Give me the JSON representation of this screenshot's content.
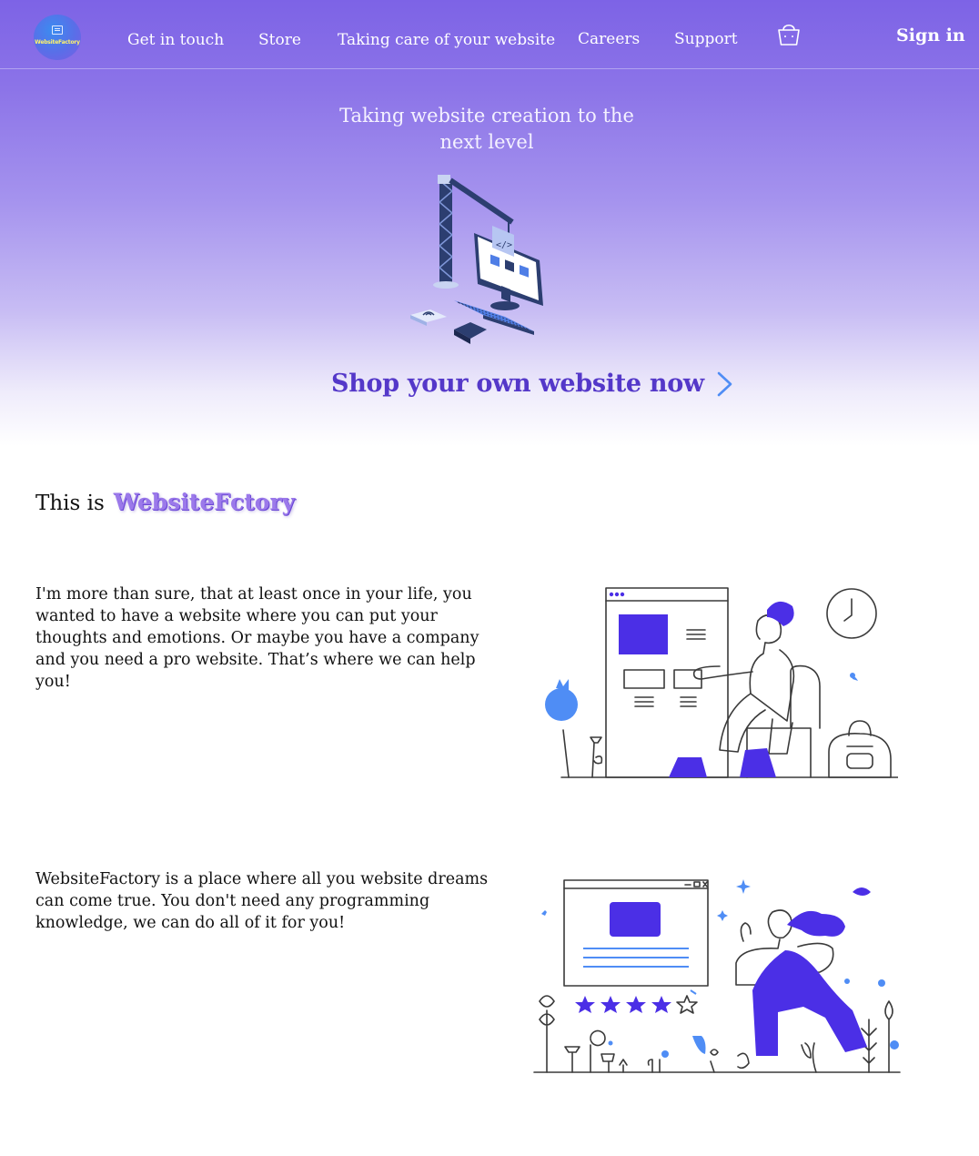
{
  "brand": {
    "logo_text": "WebsiteFactory"
  },
  "nav": {
    "links": [
      {
        "label": "Get in touch"
      },
      {
        "label": "Store"
      },
      {
        "label": "Taking care of your website"
      },
      {
        "label": "Careers"
      },
      {
        "label": "Support"
      }
    ],
    "cart_icon": "shopping-basket-icon",
    "sign_in": "Sign in"
  },
  "hero": {
    "tagline_line1": "Taking website creation to the",
    "tagline_line2": "next level",
    "illustration_icon": "crane-building-computer-illustration",
    "cta_label": "Shop your own website now",
    "cta_icon": "chevron-right-icon"
  },
  "intro": {
    "prefix": "This is",
    "brand_name": "WebsiteFctory"
  },
  "sections": [
    {
      "text": "I'm more than sure, that at least once in your life, you wanted to have a website where you can put your thoughts and emotions. Or maybe you have a company and you need a pro website. That’s where we can help you!",
      "illustration": "woman-designing-website-illustration"
    },
    {
      "text": "WebsiteFactory is a place where all you website dreams can come true. You don't need any programming knowledge, we can do all of it for you!",
      "illustration": "woman-rating-website-illustration"
    }
  ],
  "colors": {
    "hero_top": "#7d63e6",
    "cta": "#5438c9",
    "accent_blue": "#4f8df5",
    "illustration_purple": "#4b2fe6"
  }
}
